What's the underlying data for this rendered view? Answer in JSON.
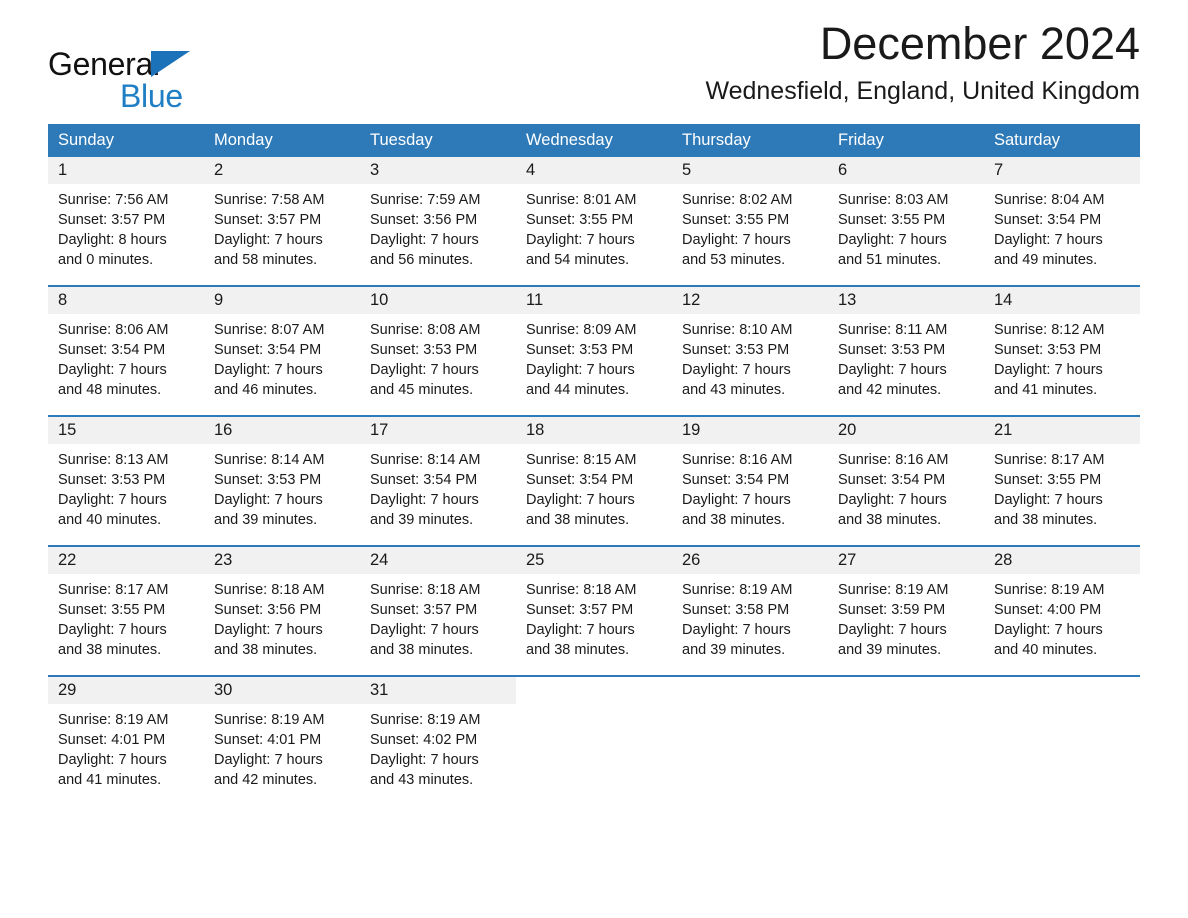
{
  "brand": {
    "name_part1": "General",
    "name_part2": "Blue",
    "accent_color": "#1c72b8"
  },
  "header": {
    "month_title": "December 2024",
    "location": "Wednesfield, England, United Kingdom"
  },
  "calendar": {
    "header_bg": "#2e7ab8",
    "daynum_bg": "#f1f1f1",
    "weekday_headers": [
      "Sunday",
      "Monday",
      "Tuesday",
      "Wednesday",
      "Thursday",
      "Friday",
      "Saturday"
    ],
    "weeks": [
      [
        {
          "day": "1",
          "sunrise": "Sunrise: 7:56 AM",
          "sunset": "Sunset: 3:57 PM",
          "daylight_line1": "Daylight: 8 hours",
          "daylight_line2": "and 0 minutes."
        },
        {
          "day": "2",
          "sunrise": "Sunrise: 7:58 AM",
          "sunset": "Sunset: 3:57 PM",
          "daylight_line1": "Daylight: 7 hours",
          "daylight_line2": "and 58 minutes."
        },
        {
          "day": "3",
          "sunrise": "Sunrise: 7:59 AM",
          "sunset": "Sunset: 3:56 PM",
          "daylight_line1": "Daylight: 7 hours",
          "daylight_line2": "and 56 minutes."
        },
        {
          "day": "4",
          "sunrise": "Sunrise: 8:01 AM",
          "sunset": "Sunset: 3:55 PM",
          "daylight_line1": "Daylight: 7 hours",
          "daylight_line2": "and 54 minutes."
        },
        {
          "day": "5",
          "sunrise": "Sunrise: 8:02 AM",
          "sunset": "Sunset: 3:55 PM",
          "daylight_line1": "Daylight: 7 hours",
          "daylight_line2": "and 53 minutes."
        },
        {
          "day": "6",
          "sunrise": "Sunrise: 8:03 AM",
          "sunset": "Sunset: 3:55 PM",
          "daylight_line1": "Daylight: 7 hours",
          "daylight_line2": "and 51 minutes."
        },
        {
          "day": "7",
          "sunrise": "Sunrise: 8:04 AM",
          "sunset": "Sunset: 3:54 PM",
          "daylight_line1": "Daylight: 7 hours",
          "daylight_line2": "and 49 minutes."
        }
      ],
      [
        {
          "day": "8",
          "sunrise": "Sunrise: 8:06 AM",
          "sunset": "Sunset: 3:54 PM",
          "daylight_line1": "Daylight: 7 hours",
          "daylight_line2": "and 48 minutes."
        },
        {
          "day": "9",
          "sunrise": "Sunrise: 8:07 AM",
          "sunset": "Sunset: 3:54 PM",
          "daylight_line1": "Daylight: 7 hours",
          "daylight_line2": "and 46 minutes."
        },
        {
          "day": "10",
          "sunrise": "Sunrise: 8:08 AM",
          "sunset": "Sunset: 3:53 PM",
          "daylight_line1": "Daylight: 7 hours",
          "daylight_line2": "and 45 minutes."
        },
        {
          "day": "11",
          "sunrise": "Sunrise: 8:09 AM",
          "sunset": "Sunset: 3:53 PM",
          "daylight_line1": "Daylight: 7 hours",
          "daylight_line2": "and 44 minutes."
        },
        {
          "day": "12",
          "sunrise": "Sunrise: 8:10 AM",
          "sunset": "Sunset: 3:53 PM",
          "daylight_line1": "Daylight: 7 hours",
          "daylight_line2": "and 43 minutes."
        },
        {
          "day": "13",
          "sunrise": "Sunrise: 8:11 AM",
          "sunset": "Sunset: 3:53 PM",
          "daylight_line1": "Daylight: 7 hours",
          "daylight_line2": "and 42 minutes."
        },
        {
          "day": "14",
          "sunrise": "Sunrise: 8:12 AM",
          "sunset": "Sunset: 3:53 PM",
          "daylight_line1": "Daylight: 7 hours",
          "daylight_line2": "and 41 minutes."
        }
      ],
      [
        {
          "day": "15",
          "sunrise": "Sunrise: 8:13 AM",
          "sunset": "Sunset: 3:53 PM",
          "daylight_line1": "Daylight: 7 hours",
          "daylight_line2": "and 40 minutes."
        },
        {
          "day": "16",
          "sunrise": "Sunrise: 8:14 AM",
          "sunset": "Sunset: 3:53 PM",
          "daylight_line1": "Daylight: 7 hours",
          "daylight_line2": "and 39 minutes."
        },
        {
          "day": "17",
          "sunrise": "Sunrise: 8:14 AM",
          "sunset": "Sunset: 3:54 PM",
          "daylight_line1": "Daylight: 7 hours",
          "daylight_line2": "and 39 minutes."
        },
        {
          "day": "18",
          "sunrise": "Sunrise: 8:15 AM",
          "sunset": "Sunset: 3:54 PM",
          "daylight_line1": "Daylight: 7 hours",
          "daylight_line2": "and 38 minutes."
        },
        {
          "day": "19",
          "sunrise": "Sunrise: 8:16 AM",
          "sunset": "Sunset: 3:54 PM",
          "daylight_line1": "Daylight: 7 hours",
          "daylight_line2": "and 38 minutes."
        },
        {
          "day": "20",
          "sunrise": "Sunrise: 8:16 AM",
          "sunset": "Sunset: 3:54 PM",
          "daylight_line1": "Daylight: 7 hours",
          "daylight_line2": "and 38 minutes."
        },
        {
          "day": "21",
          "sunrise": "Sunrise: 8:17 AM",
          "sunset": "Sunset: 3:55 PM",
          "daylight_line1": "Daylight: 7 hours",
          "daylight_line2": "and 38 minutes."
        }
      ],
      [
        {
          "day": "22",
          "sunrise": "Sunrise: 8:17 AM",
          "sunset": "Sunset: 3:55 PM",
          "daylight_line1": "Daylight: 7 hours",
          "daylight_line2": "and 38 minutes."
        },
        {
          "day": "23",
          "sunrise": "Sunrise: 8:18 AM",
          "sunset": "Sunset: 3:56 PM",
          "daylight_line1": "Daylight: 7 hours",
          "daylight_line2": "and 38 minutes."
        },
        {
          "day": "24",
          "sunrise": "Sunrise: 8:18 AM",
          "sunset": "Sunset: 3:57 PM",
          "daylight_line1": "Daylight: 7 hours",
          "daylight_line2": "and 38 minutes."
        },
        {
          "day": "25",
          "sunrise": "Sunrise: 8:18 AM",
          "sunset": "Sunset: 3:57 PM",
          "daylight_line1": "Daylight: 7 hours",
          "daylight_line2": "and 38 minutes."
        },
        {
          "day": "26",
          "sunrise": "Sunrise: 8:19 AM",
          "sunset": "Sunset: 3:58 PM",
          "daylight_line1": "Daylight: 7 hours",
          "daylight_line2": "and 39 minutes."
        },
        {
          "day": "27",
          "sunrise": "Sunrise: 8:19 AM",
          "sunset": "Sunset: 3:59 PM",
          "daylight_line1": "Daylight: 7 hours",
          "daylight_line2": "and 39 minutes."
        },
        {
          "day": "28",
          "sunrise": "Sunrise: 8:19 AM",
          "sunset": "Sunset: 4:00 PM",
          "daylight_line1": "Daylight: 7 hours",
          "daylight_line2": "and 40 minutes."
        }
      ],
      [
        {
          "day": "29",
          "sunrise": "Sunrise: 8:19 AM",
          "sunset": "Sunset: 4:01 PM",
          "daylight_line1": "Daylight: 7 hours",
          "daylight_line2": "and 41 minutes."
        },
        {
          "day": "30",
          "sunrise": "Sunrise: 8:19 AM",
          "sunset": "Sunset: 4:01 PM",
          "daylight_line1": "Daylight: 7 hours",
          "daylight_line2": "and 42 minutes."
        },
        {
          "day": "31",
          "sunrise": "Sunrise: 8:19 AM",
          "sunset": "Sunset: 4:02 PM",
          "daylight_line1": "Daylight: 7 hours",
          "daylight_line2": "and 43 minutes."
        },
        {
          "day": "",
          "sunrise": "",
          "sunset": "",
          "daylight_line1": "",
          "daylight_line2": ""
        },
        {
          "day": "",
          "sunrise": "",
          "sunset": "",
          "daylight_line1": "",
          "daylight_line2": ""
        },
        {
          "day": "",
          "sunrise": "",
          "sunset": "",
          "daylight_line1": "",
          "daylight_line2": ""
        },
        {
          "day": "",
          "sunrise": "",
          "sunset": "",
          "daylight_line1": "",
          "daylight_line2": ""
        }
      ]
    ]
  }
}
